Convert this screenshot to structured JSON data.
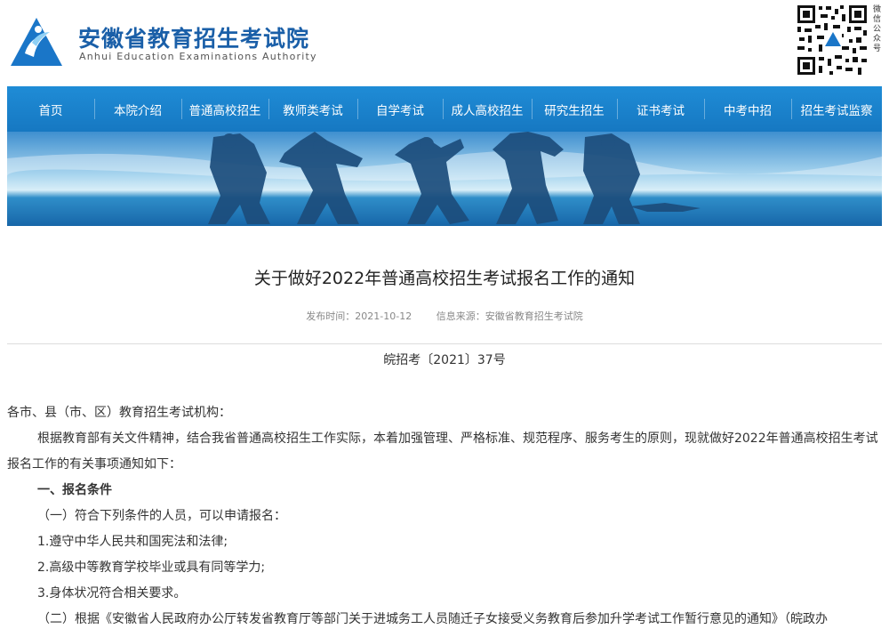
{
  "header": {
    "site_name_zh": "安徽省教育招生考试院",
    "site_name_en": "Anhui Education Examinations Authority",
    "qr_caption": "微信公众号"
  },
  "nav": {
    "items": [
      {
        "label": "首页"
      },
      {
        "label": "本院介绍"
      },
      {
        "label": "普通高校招生"
      },
      {
        "label": "教师类考试"
      },
      {
        "label": "自学考试"
      },
      {
        "label": "成人高校招生"
      },
      {
        "label": "研究生招生"
      },
      {
        "label": "证书考试"
      },
      {
        "label": "中考中招"
      },
      {
        "label": "招生考试监察"
      }
    ]
  },
  "article": {
    "title": "关于做好2022年普通高校招生考试报名工作的通知",
    "publish_time": "发布时间：2021-10-12",
    "source": "信息来源：安徽省教育招生考试院",
    "doc_number": "皖招考〔2021〕37号",
    "salutation": "各市、县（市、区）教育招生考试机构：",
    "intro": "根据教育部有关文件精神，结合我省普通高校招生工作实际，本着加强管理、严格标准、规范程序、服务考生的原则，现就做好2022年普通高校招生考试报名工作的有关事项通知如下：",
    "section1_heading": "一、报名条件",
    "sub1": "（一）符合下列条件的人员，可以申请报名：",
    "item1": "1.遵守中华人民共和国宪法和法律;",
    "item2": "2.高级中等教育学校毕业或具有同等学力;",
    "item3": "3.身体状况符合相关要求。",
    "sub2": "（二）根据《安徽省人民政府办公厅转发省教育厅等部门关于进城务工人员随迁子女接受义务教育后参加升学考试工作暂行意见的通知》（皖政办"
  },
  "colors": {
    "nav_blue": "#1678c2",
    "brand_blue": "#1a5fa8"
  }
}
